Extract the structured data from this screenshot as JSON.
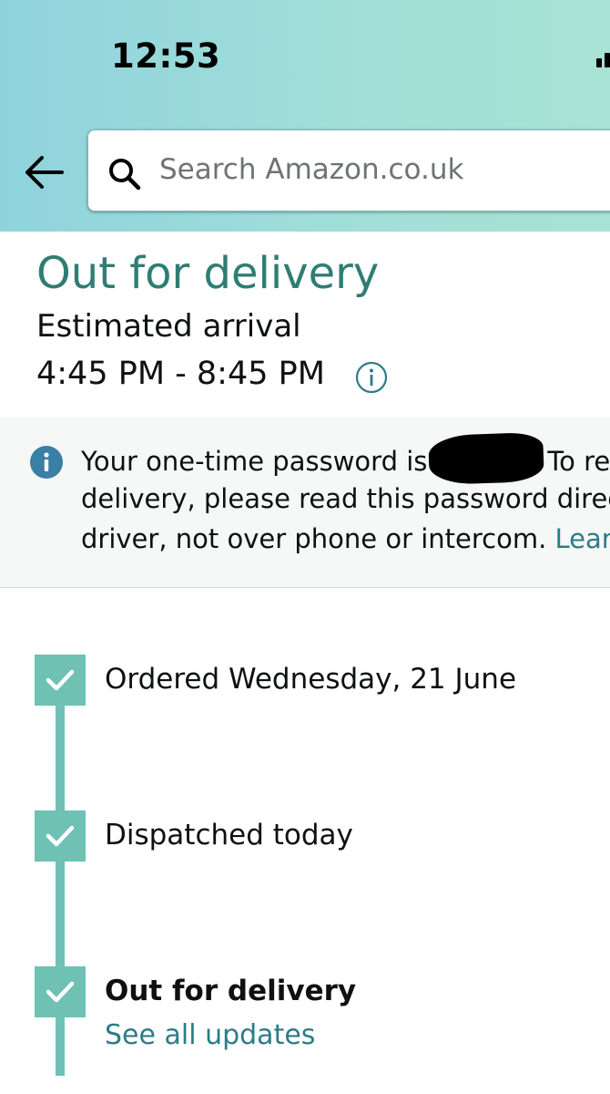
{
  "status_bar": {
    "time": "12:53"
  },
  "search": {
    "placeholder": "Search Amazon.co.uk"
  },
  "delivery": {
    "status": "Out for delivery",
    "estimated_label": "Estimated arrival",
    "estimated_range": "4:45 PM - 8:45 PM"
  },
  "otp_notice": {
    "line1_start": "Your one-time password is",
    "line1_end": "To re",
    "line2": "delivery, please read this password direc",
    "line3_start": "driver, not over phone or intercom.",
    "line3_link": "Learn"
  },
  "tracking": {
    "steps": [
      {
        "label": "Ordered Wednesday, 21 June",
        "done": true
      },
      {
        "label": "Dispatched today",
        "done": true
      },
      {
        "label": "Out for delivery",
        "done": true
      }
    ],
    "see_all_link": "See all updates"
  },
  "icons": {
    "back": "back-arrow-icon",
    "search": "search-icon",
    "info": "info-icon",
    "check": "check-icon"
  },
  "colors": {
    "status_green": "#2f7d73",
    "link_teal": "#2d7c87",
    "track_green": "#6fc1b4",
    "info_blue": "#3a7fa4"
  }
}
